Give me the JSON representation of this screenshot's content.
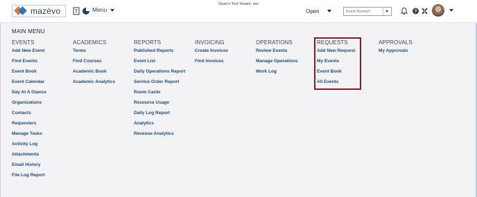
{
  "header": {
    "logo_text": "mazévo",
    "menu_label": "Menu",
    "tenant": "Dean's Test Tenant, xxx",
    "open_label": "Open",
    "search_placeholder": "Event Number"
  },
  "main": {
    "title": "MAIN MENU",
    "columns": [
      {
        "key": "events",
        "header": "EVENTS",
        "items": [
          "Add New Event",
          "Find Events",
          "Event Book",
          "Event Calendar",
          "Day At A Glance",
          "Organizations",
          "Contacts",
          "Requesters",
          "Manage Tasks",
          "Activity Log",
          "Attachments",
          "Email History",
          "File Log Report"
        ]
      },
      {
        "key": "academics",
        "header": "ACADEMICS",
        "items": [
          "Terms",
          "Find Courses",
          "Academic Book",
          "Academic Analytics"
        ]
      },
      {
        "key": "reports",
        "header": "REPORTS",
        "items": [
          "Published Reports",
          "Event List",
          "Daily Operations Report",
          "Service Order Report",
          "Room Cards",
          "Resource Usage",
          "Daily Log Report",
          "Analytics",
          "Revenue Analytics"
        ]
      },
      {
        "key": "invoicing",
        "header": "INVOICING",
        "items": [
          "Create Invoices",
          "Find Invoices"
        ]
      },
      {
        "key": "operations",
        "header": "OPERATIONS",
        "items": [
          "Review Events",
          "Manage Operations",
          "Work Log"
        ]
      },
      {
        "key": "requests",
        "header": "REQUESTS",
        "items": [
          "Add New Request",
          "My Events",
          "Event Book",
          "All Events"
        ]
      },
      {
        "key": "approvals",
        "header": "APPROVALS",
        "items": [
          "My Approvals"
        ]
      }
    ]
  },
  "colors": {
    "link": "#1e4a77",
    "highlight_border": "#8a1a1f",
    "background": "#f3f3f5"
  },
  "icons": [
    "calendar-icon",
    "pie-chart-icon",
    "bell-icon",
    "help-icon",
    "settings-icon"
  ]
}
